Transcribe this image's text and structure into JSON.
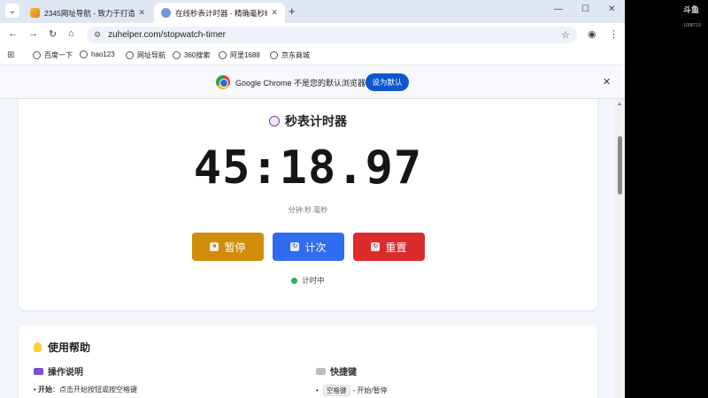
{
  "tabs": {
    "inactive_title": "2345网址导航 - 致力于打造百",
    "active_title": "在线秒表计时器 - 精确毫秒级计",
    "close_glyph": "✕",
    "new_tab_glyph": "+",
    "menu_glyph": "⌄"
  },
  "window": {
    "minimize": "—",
    "maximize": "☐",
    "close": "✕"
  },
  "toolbar": {
    "back": "←",
    "forward": "→",
    "reload": "↻",
    "home": "⌂",
    "url": "zuhelper.com/stopwatch-timer",
    "site_settings": "⚙",
    "bookmark_star": "☆",
    "profile": "◉",
    "menu": "⋮"
  },
  "bookmarks": {
    "apps_glyph": "⊞",
    "items": [
      "百度一下",
      "hao123",
      "网址导航",
      "360搜索",
      "阿里1688",
      "京东商城"
    ]
  },
  "infobar": {
    "message": "Google Chrome 不是您的默认浏览器",
    "button": "设为默认",
    "close": "✕"
  },
  "timer": {
    "title": "秒表计时器",
    "time": "45:18.97",
    "format": "分钟:秒.毫秒",
    "buttons": {
      "pause": "暂停",
      "lap": "计次",
      "reset": "重置"
    },
    "button_icons": {
      "pause": "⏸",
      "lap": "↻",
      "reset": "↻"
    },
    "status": "计时中"
  },
  "help": {
    "title": "使用帮助",
    "operations_title": "操作说明",
    "operations_first_label": "开始",
    "operations_first_text": "：点击开始按钮或按空格键",
    "shortcuts_title": "快捷键",
    "shortcut_first_key": "空格键",
    "shortcut_first_text": "- 开始/暂停"
  },
  "overlay": {
    "logo": "斗鱼",
    "id": "1006719"
  },
  "colors": {
    "pause": "#d18c0a",
    "lap": "#2f6cf0",
    "reset": "#db2c2c",
    "status_dot": "#20b55a",
    "chrome_accent": "#0b57d0"
  }
}
